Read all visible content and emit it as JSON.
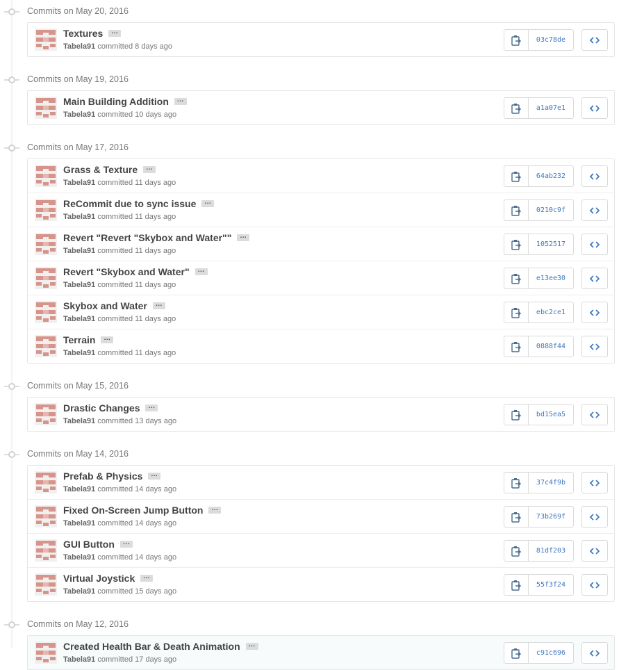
{
  "groups": [
    {
      "date_label": "Commits on May 20, 2016",
      "commits": [
        {
          "title": "Textures",
          "author": "Tabela91",
          "action": "committed",
          "time": "8 days ago",
          "sha": "03c78de"
        }
      ]
    },
    {
      "date_label": "Commits on May 19, 2016",
      "commits": [
        {
          "title": "Main Building Addition",
          "author": "Tabela91",
          "action": "committed",
          "time": "10 days ago",
          "sha": "a1a07e1"
        }
      ]
    },
    {
      "date_label": "Commits on May 17, 2016",
      "commits": [
        {
          "title": "Grass & Texture",
          "author": "Tabela91",
          "action": "committed",
          "time": "11 days ago",
          "sha": "64ab232"
        },
        {
          "title": "ReCommit due to sync issue",
          "author": "Tabela91",
          "action": "committed",
          "time": "11 days ago",
          "sha": "0210c9f"
        },
        {
          "title": "Revert \"Revert \"Skybox and Water\"\"",
          "author": "Tabela91",
          "action": "committed",
          "time": "11 days ago",
          "sha": "1052517"
        },
        {
          "title": "Revert \"Skybox and Water\"",
          "author": "Tabela91",
          "action": "committed",
          "time": "11 days ago",
          "sha": "e13ee30"
        },
        {
          "title": "Skybox and Water",
          "author": "Tabela91",
          "action": "committed",
          "time": "11 days ago",
          "sha": "ebc2ce1"
        },
        {
          "title": "Terrain",
          "author": "Tabela91",
          "action": "committed",
          "time": "11 days ago",
          "sha": "0888f44"
        }
      ]
    },
    {
      "date_label": "Commits on May 15, 2016",
      "commits": [
        {
          "title": "Drastic Changes",
          "author": "Tabela91",
          "action": "committed",
          "time": "13 days ago",
          "sha": "bd15ea5"
        }
      ]
    },
    {
      "date_label": "Commits on May 14, 2016",
      "commits": [
        {
          "title": "Prefab & Physics",
          "author": "Tabela91",
          "action": "committed",
          "time": "14 days ago",
          "sha": "37c4f9b"
        },
        {
          "title": "Fixed On-Screen Jump Button",
          "author": "Tabela91",
          "action": "committed",
          "time": "14 days ago",
          "sha": "73b269f"
        },
        {
          "title": "GUI Button",
          "author": "Tabela91",
          "action": "committed",
          "time": "14 days ago",
          "sha": "81df203"
        },
        {
          "title": "Virtual Joystick",
          "author": "Tabela91",
          "action": "committed",
          "time": "15 days ago",
          "sha": "55f3f24"
        }
      ]
    },
    {
      "date_label": "Commits on May 12, 2016",
      "commits": [
        {
          "title": "Created Health Bar & Death Animation",
          "author": "Tabela91",
          "action": "committed",
          "time": "17 days ago",
          "sha": "c91c696",
          "highlight": true
        }
      ]
    }
  ],
  "ellipsis_label": "…",
  "icons": {
    "timeline": "commit-node-icon",
    "copy": "clipboard-icon",
    "browse": "code-brackets-icon",
    "avatar": "identicon-avatar"
  },
  "colors": {
    "sha_link": "#4078c0",
    "avatar": "#d6948a",
    "meta_text": "#767676",
    "title_text": "#444444"
  }
}
